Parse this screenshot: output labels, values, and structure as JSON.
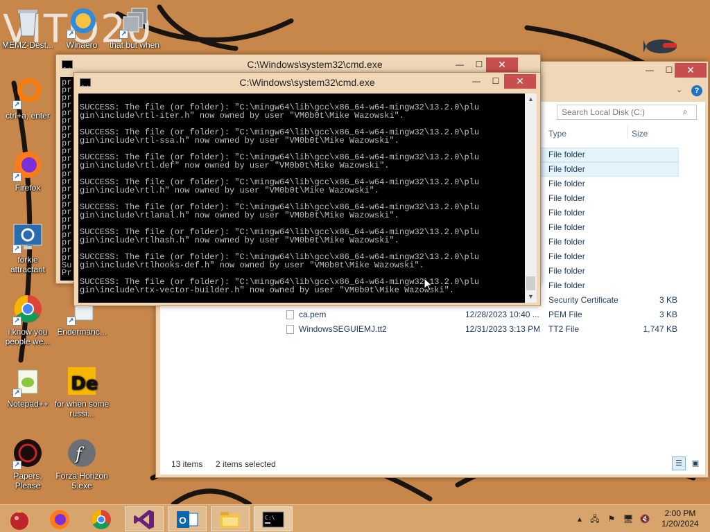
{
  "colors": {
    "wallpaper": "#c8874a",
    "window_frame": "#f0d7b7",
    "close_button": "#c7504f",
    "console_bg": "#000000",
    "console_text": "#c0c0c0",
    "taskbar": "#d7a56b"
  },
  "wallpaper": {
    "logo_text": "VITO20"
  },
  "desktop_icons": [
    {
      "label": "MEMZ-Dest...",
      "icon": "recycle-bin-icon"
    },
    {
      "label": "Winaero",
      "icon": "winaero-icon"
    },
    {
      "label": "that but when",
      "icon": "shortcut-stack-icon"
    },
    {
      "label": "ctrl+a, enter",
      "icon": "orange-ring-icon"
    },
    {
      "label": "Firefox",
      "icon": "firefox-icon"
    },
    {
      "label": "forkie attractant",
      "icon": "settings-monitor-icon"
    },
    {
      "label": "i know you people we...",
      "icon": "chrome-icon"
    },
    {
      "label": "Endermanc...",
      "icon": "document-icon"
    },
    {
      "label": "Notepad++",
      "icon": "notepad-plus-plus-icon"
    },
    {
      "label": "for when some russi...",
      "icon": "de-app-icon"
    },
    {
      "label": "Papers, Please",
      "icon": "papers-please-icon"
    },
    {
      "label": "Forza Horizon 5.exe",
      "icon": "flash-icon"
    }
  ],
  "cmd_back": {
    "title": "C:\\Windows\\system32\\cmd.exe",
    "lines": [
      "pr",
      "pr",
      "pr",
      "pr",
      "pr",
      "pr",
      "pr",
      "pr",
      "pr",
      "pr",
      "pr",
      "pr",
      "pr",
      "pr",
      "pr",
      "pr",
      "pr",
      "pr",
      "pr",
      "pr",
      "pr",
      "pr",
      "pr",
      "pr",
      "Su",
      "Pr"
    ]
  },
  "cmd_front": {
    "title": "C:\\Windows\\system32\\cmd.exe",
    "buttons": {
      "minimize": "—",
      "maximize": "☐",
      "close": "✕"
    },
    "output": [
      "SUCCESS: The file (or folder): \"C:\\mingw64\\lib\\gcc\\x86_64-w64-mingw32\\13.2.0\\plu",
      "gin\\include\\rtl-iter.h\" now owned by user \"VM0b0t\\Mike Wazowski\".",
      "",
      "SUCCESS: The file (or folder): \"C:\\mingw64\\lib\\gcc\\x86_64-w64-mingw32\\13.2.0\\plu",
      "gin\\include\\rtl-ssa.h\" now owned by user \"VM0b0t\\Mike Wazowski\".",
      "",
      "SUCCESS: The file (or folder): \"C:\\mingw64\\lib\\gcc\\x86_64-w64-mingw32\\13.2.0\\plu",
      "gin\\include\\rtl.def\" now owned by user \"VM0b0t\\Mike Wazowski\".",
      "",
      "SUCCESS: The file (or folder): \"C:\\mingw64\\lib\\gcc\\x86_64-w64-mingw32\\13.2.0\\plu",
      "gin\\include\\rtl.h\" now owned by user \"VM0b0t\\Mike Wazowski\".",
      "",
      "SUCCESS: The file (or folder): \"C:\\mingw64\\lib\\gcc\\x86_64-w64-mingw32\\13.2.0\\plu",
      "gin\\include\\rtlanal.h\" now owned by user \"VM0b0t\\Mike Wazowski\".",
      "",
      "SUCCESS: The file (or folder): \"C:\\mingw64\\lib\\gcc\\x86_64-w64-mingw32\\13.2.0\\plu",
      "gin\\include\\rtlhash.h\" now owned by user \"VM0b0t\\Mike Wazowski\".",
      "",
      "SUCCESS: The file (or folder): \"C:\\mingw64\\lib\\gcc\\x86_64-w64-mingw32\\13.2.0\\plu",
      "gin\\include\\rtlhooks-def.h\" now owned by user \"VM0b0t\\Mike Wazowski\".",
      "",
      "SUCCESS: The file (or folder): \"C:\\mingw64\\lib\\gcc\\x86_64-w64-mingw32\\13.2.0\\plu",
      "gin\\include\\rtx-vector-builder.h\" now owned by user \"VM0b0t\\Mike Wazowski\"."
    ]
  },
  "explorer": {
    "search_placeholder": "Search Local Disk (C:)",
    "columns": {
      "type": "Type",
      "size": "Size"
    },
    "rows": [
      {
        "name": "",
        "date": "",
        "type": "File folder",
        "size": "",
        "selected": true
      },
      {
        "name": "",
        "date": "",
        "type": "File folder",
        "size": "",
        "selected": true
      },
      {
        "name": "",
        "date": "",
        "type": "File folder",
        "size": "",
        "selected": false
      },
      {
        "name": "",
        "date": "",
        "type": "File folder",
        "size": "",
        "selected": false
      },
      {
        "name": "",
        "date": "",
        "type": "File folder",
        "size": "",
        "selected": false
      },
      {
        "name": "",
        "date": "",
        "type": "File folder",
        "size": "",
        "selected": false
      },
      {
        "name": "",
        "date": "",
        "type": "File folder",
        "size": "",
        "selected": false
      },
      {
        "name": "",
        "date": "",
        "type": "File folder",
        "size": "",
        "selected": false
      },
      {
        "name": "",
        "date": "",
        "type": "File folder",
        "size": "",
        "selected": false
      },
      {
        "name": "",
        "date": "",
        "type": "File folder",
        "size": "",
        "selected": false
      },
      {
        "name": "",
        "date": "",
        "type": "Security Certificate",
        "size": "3 KB",
        "selected": false
      },
      {
        "name": "ca.pem",
        "date": "12/28/2023 10:40 ...",
        "type": "PEM File",
        "size": "3 KB",
        "selected": false
      },
      {
        "name": "WindowsSEGUIEMJ.tt2",
        "date": "12/31/2023 3:13 PM",
        "type": "TT2 File",
        "size": "1,747 KB",
        "selected": false
      }
    ],
    "status": {
      "items": "13 items",
      "selected": "2 items selected"
    }
  },
  "taskbar": {
    "pinned": [
      {
        "name": "start-ornament-icon"
      },
      {
        "name": "firefox-icon"
      },
      {
        "name": "chrome-icon"
      },
      {
        "name": "visual-studio-icon"
      },
      {
        "name": "outlook-icon"
      },
      {
        "name": "file-explorer-icon"
      },
      {
        "name": "cmd-icon"
      }
    ],
    "clock": {
      "time": "2:00 PM",
      "date": "1/20/2024"
    }
  }
}
